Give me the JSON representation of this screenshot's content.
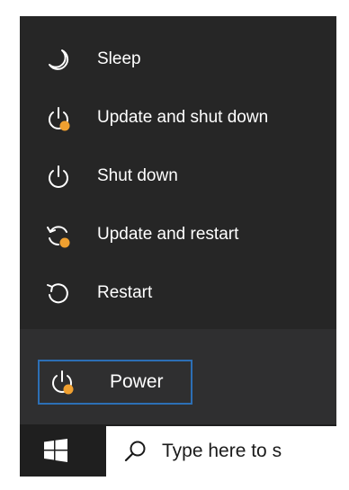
{
  "power_menu": {
    "items": [
      {
        "label": "Sleep",
        "icon": "moon-icon"
      },
      {
        "label": "Update and shut down",
        "icon": "power-update-icon"
      },
      {
        "label": "Shut down",
        "icon": "power-icon"
      },
      {
        "label": "Update and restart",
        "icon": "restart-update-icon"
      },
      {
        "label": "Restart",
        "icon": "restart-icon"
      }
    ]
  },
  "start_menu": {
    "power_button": {
      "label": "Power",
      "icon": "power-update-icon"
    }
  },
  "taskbar": {
    "start_icon": "windows-logo-icon",
    "search": {
      "placeholder": "Type here to s",
      "icon": "search-icon"
    }
  },
  "colors": {
    "menu_bg": "#262626",
    "lower_bg": "#2f2f30",
    "taskbar_bg": "#1f1f1f",
    "focus_border": "#2c6fb5",
    "update_dot": "#f0a030",
    "text": "#ffffff"
  }
}
